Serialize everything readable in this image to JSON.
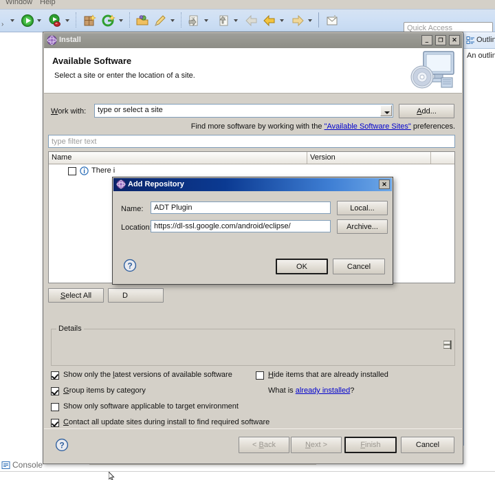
{
  "workbench": {
    "menus": [
      {
        "label": "Window",
        "x": 8
      },
      {
        "label": "Help",
        "x": 58
      }
    ],
    "toolbar_icons": [
      "run-icon",
      "debug-icon",
      "new-java-package-icon",
      "new-google-icon",
      "open-type-icon",
      "search-icon",
      "next-annotation-icon",
      "previous-annotation-icon",
      "back-icon",
      "forward-prev-icon",
      "forward-icon",
      "new-editor-icon"
    ],
    "quick_access_placeholder": "Quick Access",
    "outline": {
      "tab_label": "Outline",
      "icon": "outline-icon",
      "body_text": "An outline"
    },
    "console": {
      "tab_label": "Console",
      "icon": "console-icon"
    }
  },
  "install_dialog": {
    "title": "Install",
    "title_icon": "eclipse-globe-icon",
    "window_buttons": {
      "minimize": "–",
      "maximize": "❐",
      "close": "✕"
    },
    "header": {
      "title": "Available Software",
      "subtitle": "Select a site or enter the location of a site.",
      "image": "monitor-cd-icon"
    },
    "work_with": {
      "label": "Work with:",
      "value": "",
      "placeholder": "type or select a site",
      "add_button": "Add..."
    },
    "hint": {
      "prefix": "Find more software by working with the ",
      "link": "\"Available Software Sites\"",
      "suffix": " preferences."
    },
    "filter": {
      "placeholder": "type filter text",
      "value": ""
    },
    "table": {
      "columns": [
        "Name",
        "Version"
      ],
      "rows": [
        {
          "checked": false,
          "icon": "info-icon",
          "name": "There i",
          "version": ""
        }
      ]
    },
    "table_buttons": {
      "select_all": "Select All",
      "deselect_all": "D"
    },
    "details": {
      "group_title": "Details",
      "content": "",
      "grip": "resize-grip-icon"
    },
    "options": [
      {
        "label": "Show only the latest versions of available software",
        "checked": true,
        "mnemonic_index": 14
      },
      {
        "label": "Group items by category",
        "checked": true,
        "mnemonic_index": 0
      },
      {
        "label": "Show only software applicable to target environment",
        "checked": false,
        "mnemonic_index": -1
      },
      {
        "label": "Contact all update sites during install to find required software",
        "checked": true,
        "mnemonic_index": 0
      }
    ],
    "options_right": [
      {
        "label": "Hide items that are already installed",
        "checked": false,
        "mnemonic_index": 0
      }
    ],
    "already_installed": {
      "prefix": "What is ",
      "link": "already installed",
      "suffix": "?"
    },
    "footer": {
      "help_icon": "help-question-icon",
      "buttons": [
        {
          "label": "< Back",
          "enabled": false,
          "focused": false
        },
        {
          "label": "Next >",
          "enabled": false,
          "focused": false
        },
        {
          "label": "Finish",
          "enabled": false,
          "focused": true
        },
        {
          "label": "Cancel",
          "enabled": true,
          "focused": false
        }
      ]
    }
  },
  "add_repository_dialog": {
    "title": "Add Repository",
    "title_icon": "eclipse-globe-icon",
    "close_label": "✕",
    "fields": [
      {
        "label": "Name:",
        "value": "ADT Plugin",
        "button": "Local..."
      },
      {
        "label": "Location:",
        "value": "https://dl-ssl.google.com/android/eclipse/",
        "button": "Archive..."
      }
    ],
    "help_icon": "help-question-icon",
    "buttons": [
      {
        "label": "OK",
        "focused": true
      },
      {
        "label": "Cancel",
        "focused": false
      }
    ]
  },
  "colors": {
    "dialog_bg": "#d4d0c8",
    "active_title": "#0a246a",
    "inactive_title": "#96968f",
    "link": "#0000cd",
    "toolbar_bg": "#c5d9f1"
  }
}
